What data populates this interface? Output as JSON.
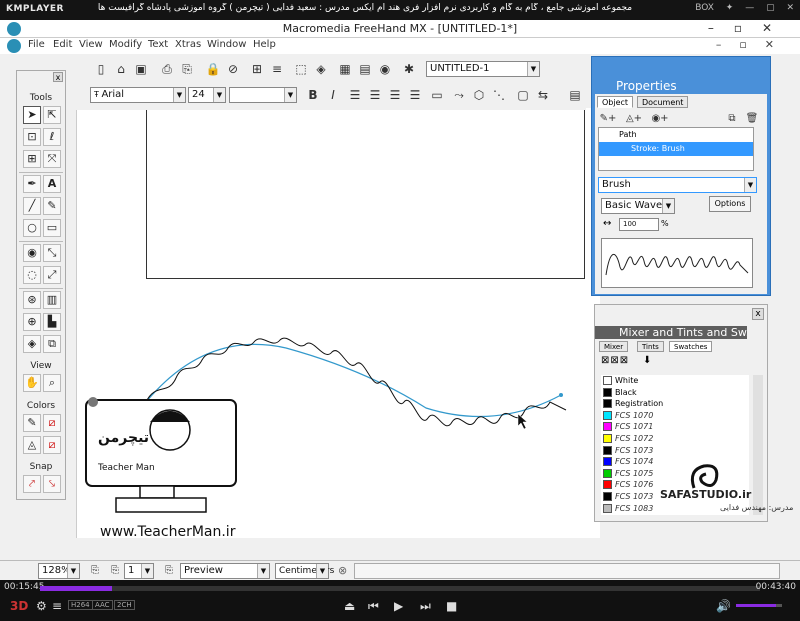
{
  "player": {
    "logo": "KMPLAYER",
    "title": "مجموعه آموزشی جامع ، گام به گام و کاربردی نرم افزار فری هند ام ایکس   مدرس : سعید فدایی ( تیچرمن ) گروه آموزشی پادشاه گرافیست ها",
    "box": "BOX",
    "time_elapsed": "00:15:45",
    "time_total": "00:43:40",
    "progress_fraction": 0.1,
    "tags": [
      "H264",
      "AAC",
      "2CH"
    ]
  },
  "app": {
    "title": "Macromedia FreeHand MX - [UNTITLED-1*]",
    "menu": [
      "File",
      "Edit",
      "View",
      "Modify",
      "Text",
      "Xtras",
      "Window",
      "Help"
    ],
    "document_select": "UNTITLED-1",
    "font_family": "Arial",
    "font_size": "24"
  },
  "toolbox": {
    "close": "x",
    "sections": {
      "tools": "Tools",
      "view": "View",
      "colors": "Colors",
      "snap": "Snap"
    }
  },
  "properties": {
    "title": "Properties",
    "tabs": [
      "Object",
      "Document"
    ],
    "tree": [
      "Path",
      "Stroke: Brush"
    ],
    "stroke_type": "Brush",
    "brush": "Basic Wave",
    "options_label": "Options",
    "width_value": "100",
    "width_unit": "%"
  },
  "mixer": {
    "close": "x",
    "title": "Mixer and Tints and Sw...",
    "tabs": [
      "Mixer",
      "Tints",
      "Swatches"
    ],
    "swatches": [
      {
        "name": "White",
        "color": "#ffffff",
        "italic": false
      },
      {
        "name": "Black",
        "color": "#000000",
        "italic": false
      },
      {
        "name": "Registration",
        "color": "#000000",
        "italic": false
      },
      {
        "name": "FCS 1070",
        "color": "#00e5ff",
        "italic": true
      },
      {
        "name": "FCS 1071",
        "color": "#ff00ff",
        "italic": true
      },
      {
        "name": "FCS 1072",
        "color": "#ffff00",
        "italic": true
      },
      {
        "name": "FCS 1073",
        "color": "#000000",
        "italic": true
      },
      {
        "name": "FCS 1074",
        "color": "#0000ff",
        "italic": true
      },
      {
        "name": "FCS 1075",
        "color": "#00cc00",
        "italic": true
      },
      {
        "name": "FCS 1076",
        "color": "#ff0000",
        "italic": true
      },
      {
        "name": "FCS 1073",
        "color": "#000000",
        "italic": true
      },
      {
        "name": "FCS 1083",
        "color": "#bbbbbb",
        "italic": true
      }
    ]
  },
  "status": {
    "zoom": "128%",
    "page": "1",
    "view_mode": "Preview",
    "units": "Centimeters"
  },
  "watermark": {
    "site": "www.TeacherMan.ir",
    "safa": "SAFASTUDIO.ir",
    "safa_sub": "مدرس: مهندس فدایی",
    "badge_name": "Teacher Man",
    "badge_fa": "تیچرمن"
  },
  "colors": {
    "accent": "#4a90d9",
    "selection": "#3399ff",
    "progress": "#8a2be2",
    "path": "#3399cc"
  }
}
